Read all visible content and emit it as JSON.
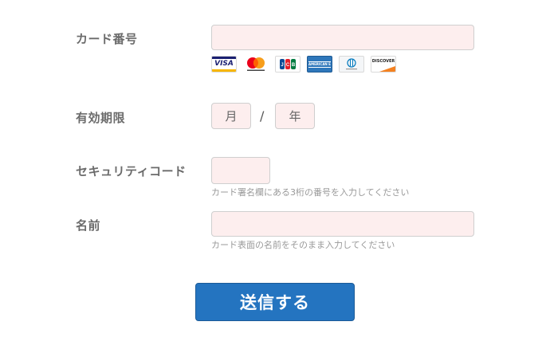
{
  "card_number": {
    "label": "カード番号",
    "value": "",
    "brands": [
      "VISA",
      "Mastercard",
      "JCB",
      "AMERICAN EXPRESS",
      "Diners Club",
      "DISCOVER"
    ]
  },
  "expiry": {
    "label": "有効期限",
    "month_placeholder": "月",
    "separator": "/",
    "year_placeholder": "年"
  },
  "security_code": {
    "label": "セキュリティコード",
    "hint": "カード署名欄にある3桁の番号を入力してください"
  },
  "name": {
    "label": "名前",
    "hint": "カード表面の名前をそのまま入力してください"
  },
  "submit_label": "送信する",
  "colors": {
    "submit_bg": "#2474c0",
    "field_bg": "#fdeeee",
    "label_text": "#6b6b6b",
    "hint_text": "#999999"
  }
}
